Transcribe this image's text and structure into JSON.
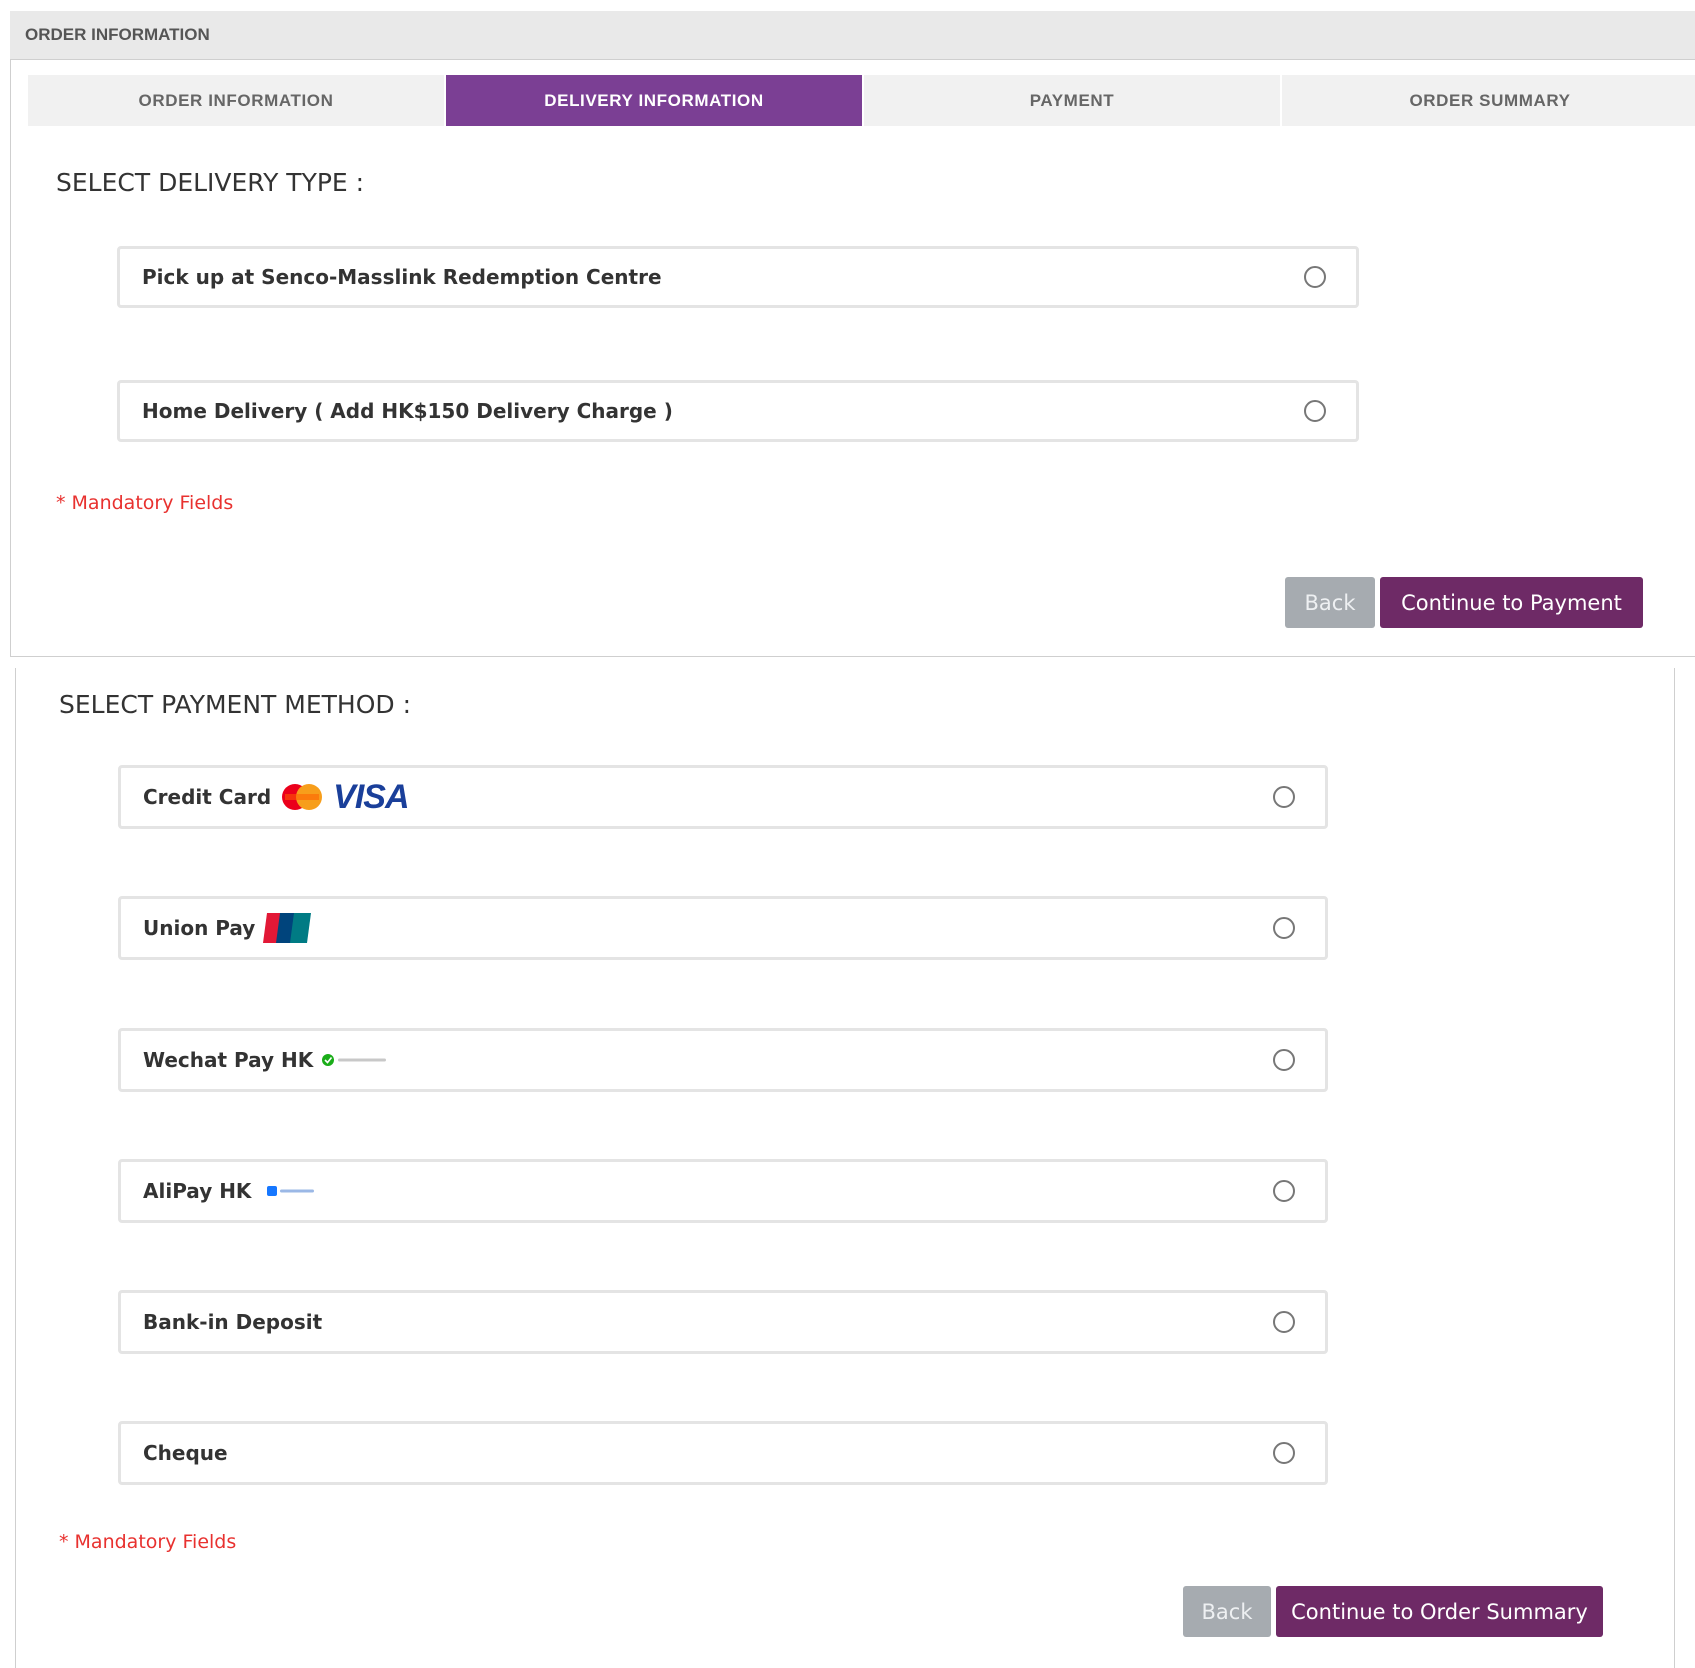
{
  "header": {
    "title": "ORDER INFORMATION"
  },
  "tabs": [
    {
      "label": "ORDER INFORMATION",
      "active": false
    },
    {
      "label": "DELIVERY INFORMATION",
      "active": true
    },
    {
      "label": "PAYMENT",
      "active": false
    },
    {
      "label": "ORDER SUMMARY",
      "active": false
    }
  ],
  "delivery": {
    "title": "SELECT DELIVERY TYPE :",
    "options": [
      {
        "label": "Pick up at Senco-Masslink Redemption Centre",
        "selected": false
      },
      {
        "label": "Home Delivery ( Add  HK$150  Delivery Charge )",
        "selected": false
      }
    ],
    "mandatory": "* Mandatory Fields",
    "back_label": "Back",
    "continue_label": "Continue to Payment"
  },
  "payment": {
    "title": "SELECT PAYMENT METHOD :",
    "options": [
      {
        "label": "Credit Card",
        "logos": [
          "mastercard-logo",
          "visa-logo"
        ],
        "visa_text": "VISA",
        "selected": false
      },
      {
        "label": "Union Pay",
        "logos": [
          "unionpay-logo"
        ],
        "selected": false
      },
      {
        "label": "Wechat Pay HK",
        "logos": [
          "wechat-pay-logo"
        ],
        "selected": false
      },
      {
        "label": "AliPay HK",
        "logos": [
          "alipay-logo"
        ],
        "selected": false
      },
      {
        "label": "Bank-in Deposit",
        "selected": false
      },
      {
        "label": "Cheque",
        "selected": false
      }
    ],
    "mandatory": "* Mandatory Fields",
    "back_label": "Back",
    "continue_label": "Continue to Order Summary"
  },
  "colors": {
    "accent_tab": "#7b3f94",
    "primary_button": "#6e2a66",
    "back_button": "#a6abb0",
    "mandatory_text": "#e8312f"
  }
}
